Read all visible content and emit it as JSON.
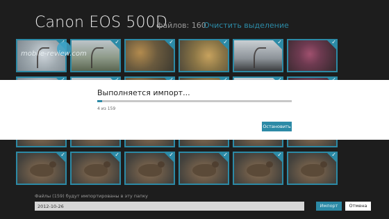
{
  "header": {
    "device_title": "Canon EOS 500D",
    "file_count": "файлов: 160",
    "clear_selection": "Очистить выделение"
  },
  "watermark": {
    "text": "mobile-review.com"
  },
  "import_dialog": {
    "title": "Выполняется импорт...",
    "progress_text": "4 из 159",
    "progress_fraction": 0.025,
    "stop_label": "Остановить"
  },
  "footer": {
    "folder_label": "Файлы (159) будут импортированы в эту папку",
    "folder_value": "2012-10-26",
    "import_label": "Импорт",
    "cancel_label": "Отмена"
  },
  "thumbnails": {
    "rows": [
      [
        "branch",
        "tree",
        "autumn",
        "leaves",
        "bare",
        "flower"
      ],
      [
        "branch",
        "tree",
        "autumn",
        "leaves",
        "bare",
        "flower"
      ],
      [
        "duck",
        "duck",
        "duck",
        "duck",
        "duck",
        "duck"
      ],
      [
        "duck",
        "duck",
        "duck",
        "duck",
        "duck",
        "duck"
      ]
    ],
    "check_icon": "checkmark-icon"
  },
  "colors": {
    "accent": "#2c8aa6",
    "background": "#1d1d1d",
    "dialog": "#ffffff"
  }
}
